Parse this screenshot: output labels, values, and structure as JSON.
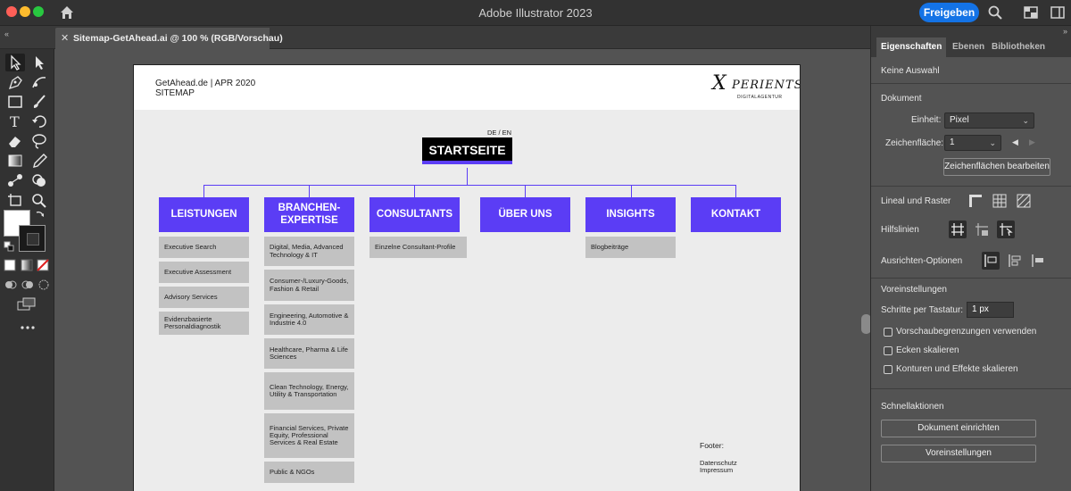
{
  "window": {
    "app_title": "Adobe Illustrator 2023",
    "share_label": "Freigeben"
  },
  "document_tab": {
    "close": "✕",
    "label": "Sitemap-GetAhead.ai @ 100 % (RGB/Vorschau)"
  },
  "artboard": {
    "header_line1": "GetAhead.de | APR 2020",
    "header_line2": "SITEMAP",
    "logo_big": "X",
    "logo_rest": "PERIENTS",
    "logo_sub": "DIGITALAGENTUR",
    "lang_switch": "DE / EN",
    "start_label": "STARTSEITE",
    "categories": [
      {
        "label": "LEISTUNGEN",
        "subitems": [
          "Executive Search",
          "Executive Assessment",
          "Advisory Services",
          "Evidenzbasierte Personaldiagnostik"
        ]
      },
      {
        "label": "BRANCHEN-\nEXPERTISE",
        "subitems": [
          "Digital, Media, Advanced Technology & IT",
          "Consumer-/Luxury-Goods, Fashion & Retail",
          "Engineering, Automotive & Industrie 4.0",
          "Healthcare, Pharma & Life Sciences",
          "Clean Technology, Energy, Utility & Transportation",
          "Financial Services, Private Equity, Professional Services & Real Estate",
          "Public & NGOs"
        ]
      },
      {
        "label": "CONSULTANTS",
        "subitems": [
          "Einzelne Consultant-Profile"
        ]
      },
      {
        "label": "ÜBER UNS",
        "subitems": []
      },
      {
        "label": "INSIGHTS",
        "subitems": [
          "Blogbeiträge"
        ]
      },
      {
        "label": "KONTAKT",
        "subitems": []
      }
    ],
    "footer_label": "Footer:",
    "footer_items": [
      "Datenschutz",
      "Impressum"
    ]
  },
  "panel": {
    "tabs": [
      "Eigenschaften",
      "Ebenen",
      "Bibliotheken"
    ],
    "no_selection": "Keine Auswahl",
    "document_heading": "Dokument",
    "unit_label": "Einheit:",
    "unit_value": "Pixel",
    "artboard_label": "Zeichenfläche:",
    "artboard_value": "1",
    "edit_artboards": "Zeichenflächen bearbeiten",
    "rulers_grid": "Lineal und Raster",
    "guides": "Hilfslinien",
    "align_options": "Ausrichten-Optionen",
    "preferences_heading": "Voreinstellungen",
    "keyboard_increment_label": "Schritte per Tastatur:",
    "keyboard_increment_value": "1 px",
    "checkboxes": [
      "Vorschaubegrenzungen verwenden",
      "Ecken skalieren",
      "Konturen und Effekte skalieren"
    ],
    "quick_actions": "Schnellaktionen",
    "document_setup": "Dokument einrichten",
    "preferences_button": "Voreinstellungen"
  },
  "colors": {
    "accent_purple": "#5b3df5",
    "share_blue": "#1473e6",
    "sub_grey": "#c2c2c2"
  }
}
